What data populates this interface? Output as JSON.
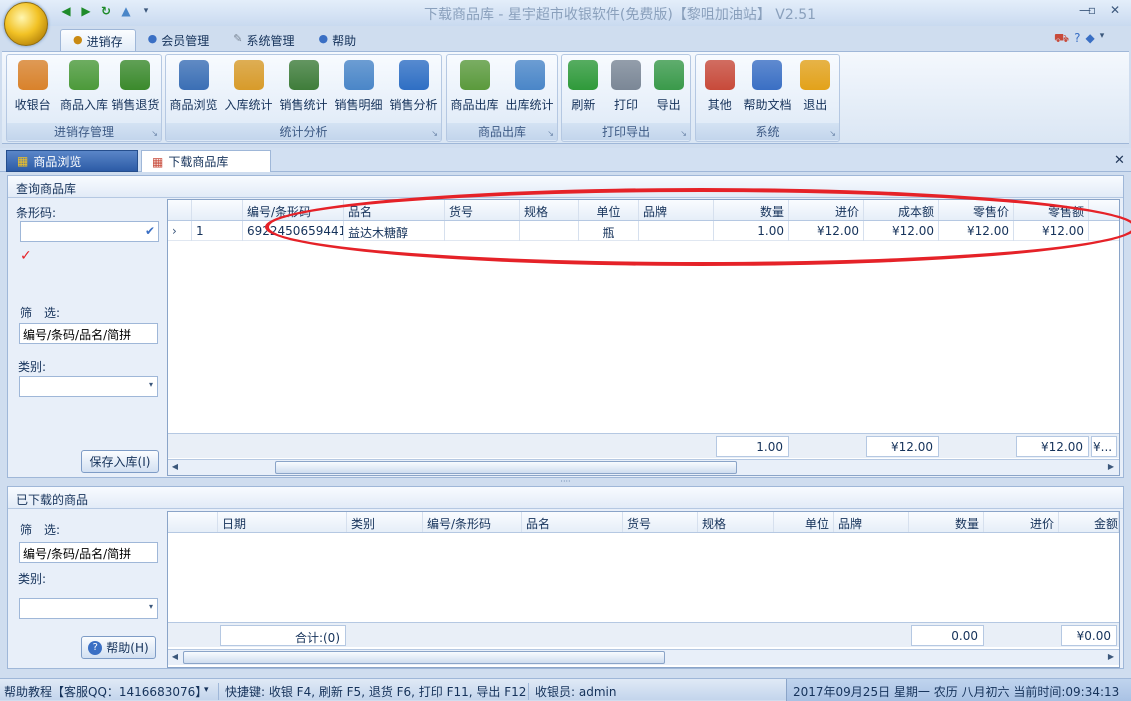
{
  "window": {
    "title": "下载商品库 - 星宇超市收银软件(免费版)【黎咀加油站】 V2.51"
  },
  "menu_tabs": [
    {
      "label": "进销存",
      "active": true,
      "icon": "coins-icon"
    },
    {
      "label": "会员管理",
      "active": false,
      "icon": "members-icon"
    },
    {
      "label": "系统管理",
      "active": false,
      "icon": "tools-icon"
    },
    {
      "label": "帮助",
      "active": false,
      "icon": "help-icon"
    }
  ],
  "ribbon": {
    "groups": [
      {
        "label": "进销存管理",
        "buttons": [
          {
            "label": "收银台",
            "icon": "cash-register-icon",
            "color": "#d9822b"
          },
          {
            "label": "商品入库",
            "icon": "stock-in-icon",
            "color": "#4c9a3a"
          },
          {
            "label": "销售退货",
            "icon": "return-icon",
            "color": "#3b8a2c"
          }
        ]
      },
      {
        "label": "统计分析",
        "buttons": [
          {
            "label": "商品浏览",
            "icon": "browse-icon",
            "color": "#3b6fb5"
          },
          {
            "label": "入库统计",
            "icon": "stock-stats-icon",
            "color": "#d89b2a"
          },
          {
            "label": "销售统计",
            "icon": "sales-stats-icon",
            "color": "#3f7d3a"
          },
          {
            "label": "销售明细",
            "icon": "sales-detail-icon",
            "color": "#4a86c8"
          },
          {
            "label": "销售分析",
            "icon": "pie-chart-icon",
            "color": "#2f6fc4"
          }
        ]
      },
      {
        "label": "商品出库",
        "buttons": [
          {
            "label": "商品出库",
            "icon": "stock-out-icon",
            "color": "#5b9a3c"
          },
          {
            "label": "出库统计",
            "icon": "out-stats-icon",
            "color": "#4a86c8"
          }
        ]
      },
      {
        "label": "打印导出",
        "buttons": [
          {
            "label": "刷新",
            "icon": "refresh-icon",
            "color": "#2f9a3a"
          },
          {
            "label": "打印",
            "icon": "printer-icon",
            "color": "#7b8796"
          },
          {
            "label": "导出",
            "icon": "export-icon",
            "color": "#3a9a4a"
          }
        ]
      },
      {
        "label": "系统",
        "buttons": [
          {
            "label": "其他",
            "icon": "grid-icon",
            "color": "#c84a3a"
          },
          {
            "label": "帮助文档",
            "icon": "help-doc-icon",
            "color": "#3a6fc4"
          },
          {
            "label": "退出",
            "icon": "power-icon",
            "color": "#e3a21a"
          }
        ]
      }
    ]
  },
  "doc_tabs": [
    {
      "label": "商品浏览",
      "active": false
    },
    {
      "label": "下载商品库",
      "active": true
    }
  ],
  "query_panel": {
    "header": "查询商品库",
    "barcode_label": "条形码:",
    "barcode_value": "",
    "filter_label": "筛　选:",
    "filter_value": "编号/条码/品名/简拼",
    "category_label": "类别:",
    "category_value": "",
    "save_button": "保存入库(I)",
    "columns": [
      "",
      "",
      "编号/条形码",
      "品名",
      "货号",
      "规格",
      "单位",
      "品牌",
      "数量",
      "进价",
      "成本额",
      "零售价",
      "零售额"
    ],
    "rows": [
      {
        "index": "1",
        "code": "6922450659441",
        "name": "益达木糖醇",
        "item_no": "",
        "spec": "",
        "unit": "瓶",
        "brand": "",
        "qty": "1.00",
        "cost_price": "¥12.00",
        "cost_amount": "¥12.00",
        "retail_price": "¥12.00",
        "retail_amount": "¥12.00"
      }
    ],
    "footer": {
      "qty": "1.00",
      "cost_amount": "¥12.00",
      "retail_amount": "¥12.00",
      "extra": "¥..."
    }
  },
  "downloaded_panel": {
    "header": "已下载的商品",
    "filter_label": "筛　选:",
    "filter_value": "编号/条码/品名/简拼",
    "category_label": "类别:",
    "category_value": "",
    "help_button": "帮助(H)",
    "columns": [
      "",
      "日期",
      "类别",
      "编号/条形码",
      "品名",
      "货号",
      "规格",
      "单位",
      "品牌",
      "数量",
      "进价",
      "金额"
    ],
    "footer": {
      "count": "合计:(0)",
      "qty": "0.00",
      "amount": "¥0.00"
    }
  },
  "status_bar": {
    "help": "帮助教程【客服QQ：1416683076】",
    "shortcuts": "快捷键: 收银 F4, 刷新 F5, 退货 F6, 打印 F11, 导出 F12",
    "cashier": "收银员: admin",
    "datetime": "2017年09月25日 星期一 农历 八月初六 当前时间:09:34:13"
  }
}
